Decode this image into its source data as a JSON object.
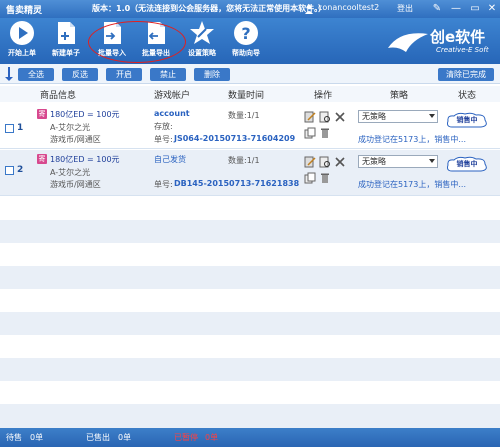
{
  "titlebar": {
    "app_name": "售卖精灵",
    "version_text": "版本：1.0（无法连接到公会服务器，您将无法正常使用本软件。）",
    "username": "conancooltest2",
    "logout_label": "登出"
  },
  "toolbar": {
    "items": [
      {
        "label": "开始上单",
        "icon": "play-icon"
      },
      {
        "label": "新建单子",
        "icon": "new-doc-icon"
      },
      {
        "label": "批量导入",
        "icon": "import-icon"
      },
      {
        "label": "批量导出",
        "icon": "export-icon"
      },
      {
        "label": "设置策略",
        "icon": "strategy-icon"
      },
      {
        "label": "帮助向导",
        "icon": "help-icon"
      }
    ],
    "brand_name": "创e软件",
    "brand_sub": "Creative-E Soft"
  },
  "actions": {
    "select_all": "全选",
    "invert": "反选",
    "start": "开启",
    "disable": "禁止",
    "delete": "删除",
    "clear_completed": "清除已完成"
  },
  "table": {
    "headers": {
      "product": "商品信息",
      "account": "游戏帐户",
      "quantity": "数量时间",
      "ops": "操作",
      "strategy": "策略",
      "status": "状态"
    },
    "rows": [
      {
        "index": "1",
        "badge": "寄",
        "price": "180亿ED = 100元",
        "server": "A-艾尔之光",
        "category": "游戏币/网通区",
        "account_line1": "account",
        "account_line2": "存放:",
        "order_label": "单号:",
        "order_no": "JS064-20150713-71604209",
        "quantity": "数量:1/1",
        "strategy_value": "无策略",
        "sync_text": "成功登记在5173上，销售中...",
        "status_text": "销售中"
      },
      {
        "index": "2",
        "badge": "寄",
        "price": "180亿ED = 100元",
        "server": "A-艾尔之光",
        "category": "游戏币/网通区",
        "account_line1": "自己发货",
        "account_line2": "",
        "order_label": "单号:",
        "order_no": "DB145-20150713-71621838",
        "quantity": "数量:1/1",
        "strategy_value": "无策略",
        "sync_text": "成功登记在5173上，销售中...",
        "status_text": "销售中"
      }
    ]
  },
  "statusbar": {
    "pending_label": "待售",
    "pending_value": "0单",
    "sold_label": "已售出",
    "sold_value": "0单",
    "stopped_label": "已暂停",
    "stopped_value": "0单"
  },
  "colors": {
    "toolbar": "#2f6fbf",
    "action_button": "#3a78c8",
    "badge": "#d7488e",
    "link_blue": "#2a62c0",
    "alert_red": "#e02020"
  }
}
